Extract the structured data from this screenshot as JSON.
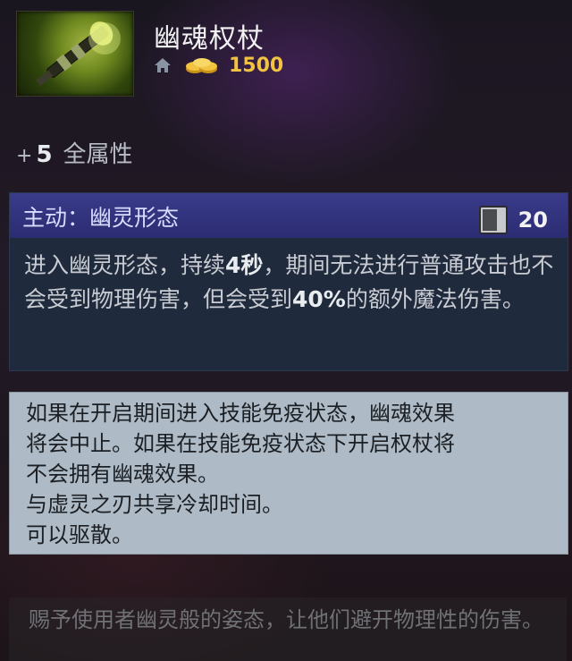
{
  "item": {
    "name": "幽魂权杖",
    "icon": "ghost-scepter-icon",
    "shop_icon": "home-icon",
    "gold_icon": "gold-coins-icon",
    "cost": "1500"
  },
  "attribute": {
    "plus": "+",
    "value": "5",
    "label": "全属性"
  },
  "active": {
    "title": "主动：幽灵形态",
    "cooldown_icon": "cooldown-icon",
    "cooldown": "20",
    "desc_part1": "进入幽灵形态，持续",
    "desc_duration": "4秒",
    "desc_part2": "，期间无法进行普通攻击也不会受到物理伤害，但会受到",
    "desc_percent": "40%",
    "desc_part3": "的额外魔法伤害。"
  },
  "notes": [
    "如果在开启期间进入技能免疫状态，幽魂效果",
    "将会中止。如果在技能免疫状态下开启权杖将",
    "不会拥有幽魂效果。",
    "与虚灵之刃共享冷却时间。",
    "可以驱散。"
  ],
  "lore": "赐予使用者幽灵般的姿态，让他们避开物理性的伤害。",
  "colors": {
    "gold": "#f1c340",
    "active_header": "#2b2c72",
    "notes_bg": "#aebac5"
  }
}
